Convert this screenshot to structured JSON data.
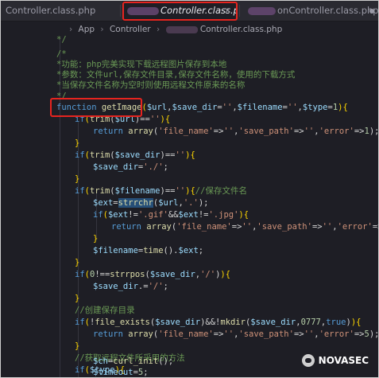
{
  "tabs": [
    {
      "label": "Controller.class.php",
      "active": false
    },
    {
      "label": "Controller.class.php",
      "active": true
    },
    {
      "label": "onController.class.php",
      "active": false
    }
  ],
  "breadcrumb": {
    "items": [
      "App",
      "Controller"
    ],
    "file": "Controller.class.php"
  },
  "code": {
    "comment_open": "/*",
    "comment_1": "*功能：php完美实现下载远程图片保存到本地",
    "comment_2": "*参数：文件url,保存文件目录,保存文件名称，使用的下载方式",
    "comment_3": "*当保存文件名称为空时则使用远程文件原来的名称",
    "comment_close": "*/",
    "comment_mkdir": "//创建保存目录",
    "comment_fetch": "//获取远程文件所采用的方法",
    "comment_name": "//保存文件名"
  },
  "watermark": "NOVASEC",
  "colors": {
    "highlight_box": "#e6241f",
    "background": "#1e1e25"
  }
}
